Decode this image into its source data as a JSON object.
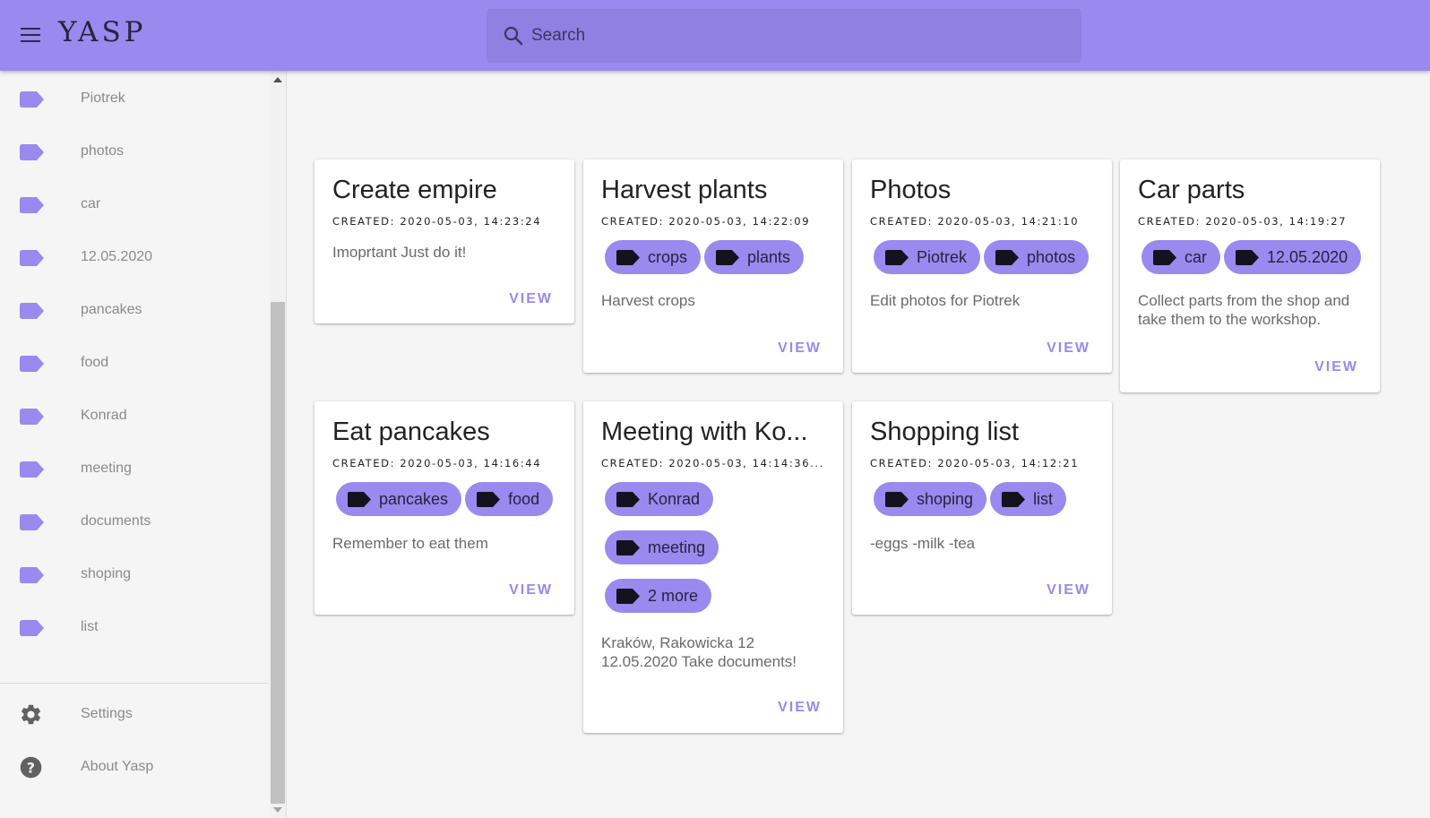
{
  "app": {
    "title": "YASP"
  },
  "search": {
    "placeholder": "Search"
  },
  "sidebar": {
    "tags": [
      {
        "label": "Piotrek"
      },
      {
        "label": "photos"
      },
      {
        "label": "car"
      },
      {
        "label": "12.05.2020"
      },
      {
        "label": "pancakes"
      },
      {
        "label": "food"
      },
      {
        "label": "Konrad"
      },
      {
        "label": "meeting"
      },
      {
        "label": "documents"
      },
      {
        "label": "shoping"
      },
      {
        "label": "list"
      }
    ],
    "settings_label": "Settings",
    "about_label": "About Yasp"
  },
  "colors": {
    "accent": "#9a89ee",
    "search_bg": "#8f80e2",
    "tag_icon": "#9a89ee",
    "chip_text": "#26233f"
  },
  "icons": {
    "tag": "label-icon",
    "search": "search-icon",
    "menu": "menu-icon",
    "settings": "gear-icon",
    "about": "help-icon"
  },
  "notes": [
    {
      "title": "Create empire",
      "created": "CREATED: 2020-05-03, 14:23:24",
      "tags": [],
      "description": "Imoprtant Just do it!",
      "view_label": "VIEW"
    },
    {
      "title": "Harvest plants",
      "created": "CREATED: 2020-05-03, 14:22:09",
      "tags": [
        "crops",
        "plants"
      ],
      "description": "Harvest crops",
      "view_label": "VIEW"
    },
    {
      "title": "Photos",
      "created": "CREATED: 2020-05-03, 14:21:10",
      "tags": [
        "Piotrek",
        "photos"
      ],
      "description": "Edit photos for Piotrek",
      "view_label": "VIEW"
    },
    {
      "title": "Car parts",
      "created": "CREATED: 2020-05-03, 14:19:27",
      "tags": [
        "car",
        "12.05.2020"
      ],
      "description": "Collect parts from the shop and take them to the workshop.",
      "view_label": "VIEW"
    },
    {
      "title": "Eat pancakes",
      "created": "CREATED: 2020-05-03, 14:16:44",
      "tags": [
        "pancakes",
        "food"
      ],
      "description": "Remember to eat them",
      "view_label": "VIEW"
    },
    {
      "title": "Meeting with Ko...",
      "created": "CREATED: 2020-05-03, 14:14:36...",
      "tags": [
        "Konrad",
        "meeting",
        "2 more"
      ],
      "description": "Kraków, Rakowicka 12 12.05.2020 Take documents!",
      "view_label": "VIEW"
    },
    {
      "title": "Shopping list",
      "created": "CREATED: 2020-05-03, 14:12:21",
      "tags": [
        "shoping",
        "list"
      ],
      "description": "-eggs -milk -tea",
      "view_label": "VIEW"
    }
  ]
}
